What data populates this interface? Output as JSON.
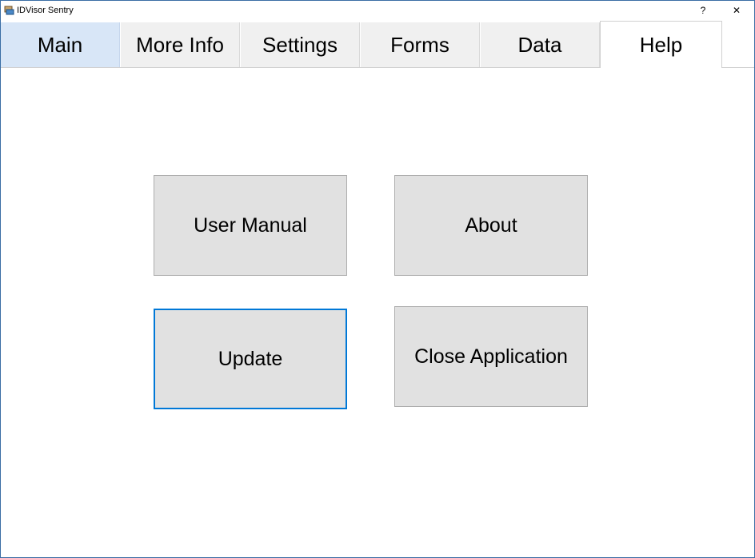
{
  "window": {
    "title": "IDVisor Sentry",
    "help_glyph": "?",
    "close_glyph": "✕"
  },
  "tabs": [
    {
      "label": "Main"
    },
    {
      "label": "More Info"
    },
    {
      "label": "Settings"
    },
    {
      "label": "Forms"
    },
    {
      "label": "Data"
    },
    {
      "label": "Help"
    }
  ],
  "selected_tab": "Help",
  "help_panel": {
    "user_manual_label": "User Manual",
    "about_label": "About",
    "update_label": "Update",
    "close_application_label": "Close Application"
  },
  "colors": {
    "accent": "#0078d7",
    "tab_hover": "#d8e6f7",
    "button_face": "#e1e1e1"
  }
}
